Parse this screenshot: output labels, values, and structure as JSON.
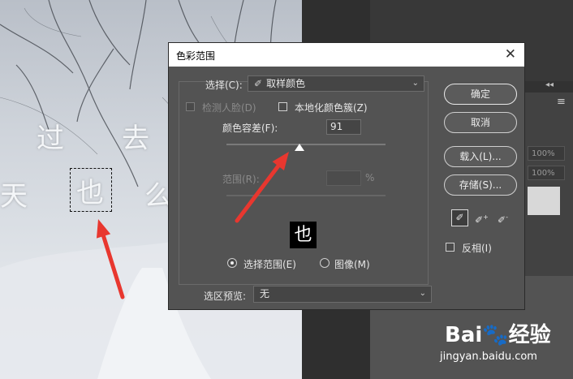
{
  "canvas": {
    "chars": {
      "guo": "过",
      "qu": "去",
      "tian": "天",
      "ye": "也",
      "partial": "么"
    }
  },
  "side_panel": {
    "collapse_glyph": "◂◂",
    "menu_glyph": "≡",
    "fields": [
      "100%",
      "100%"
    ]
  },
  "dialog": {
    "title": "色彩范围",
    "close_glyph": "✕",
    "select_label": "选择(C):",
    "select_value": "取样颜色",
    "detect_faces_label": "检测人脸(D)",
    "localized_clusters_label": "本地化颜色簇(Z)",
    "fuzziness_label": "颜色容差(F):",
    "fuzziness_value": "91",
    "fuzziness_level": 0.46,
    "range_label": "范围(R):",
    "range_unit": "%",
    "preview_char": "也",
    "radio_selection_label": "选择范围(E)",
    "radio_image_label": "图像(M)",
    "selection_preview_label": "选区预览:",
    "selection_preview_value": "无",
    "buttons": {
      "ok": "确定",
      "cancel": "取消",
      "load": "载入(L)...",
      "save": "存储(S)..."
    },
    "invert_label": "反相(I)"
  },
  "annotation": {
    "arrow_color": "#e8372f"
  },
  "watermark": {
    "logo_left": "Bai",
    "logo_paw": "🐾",
    "logo_right": "经验",
    "url": "jingyan.baidu.com"
  }
}
